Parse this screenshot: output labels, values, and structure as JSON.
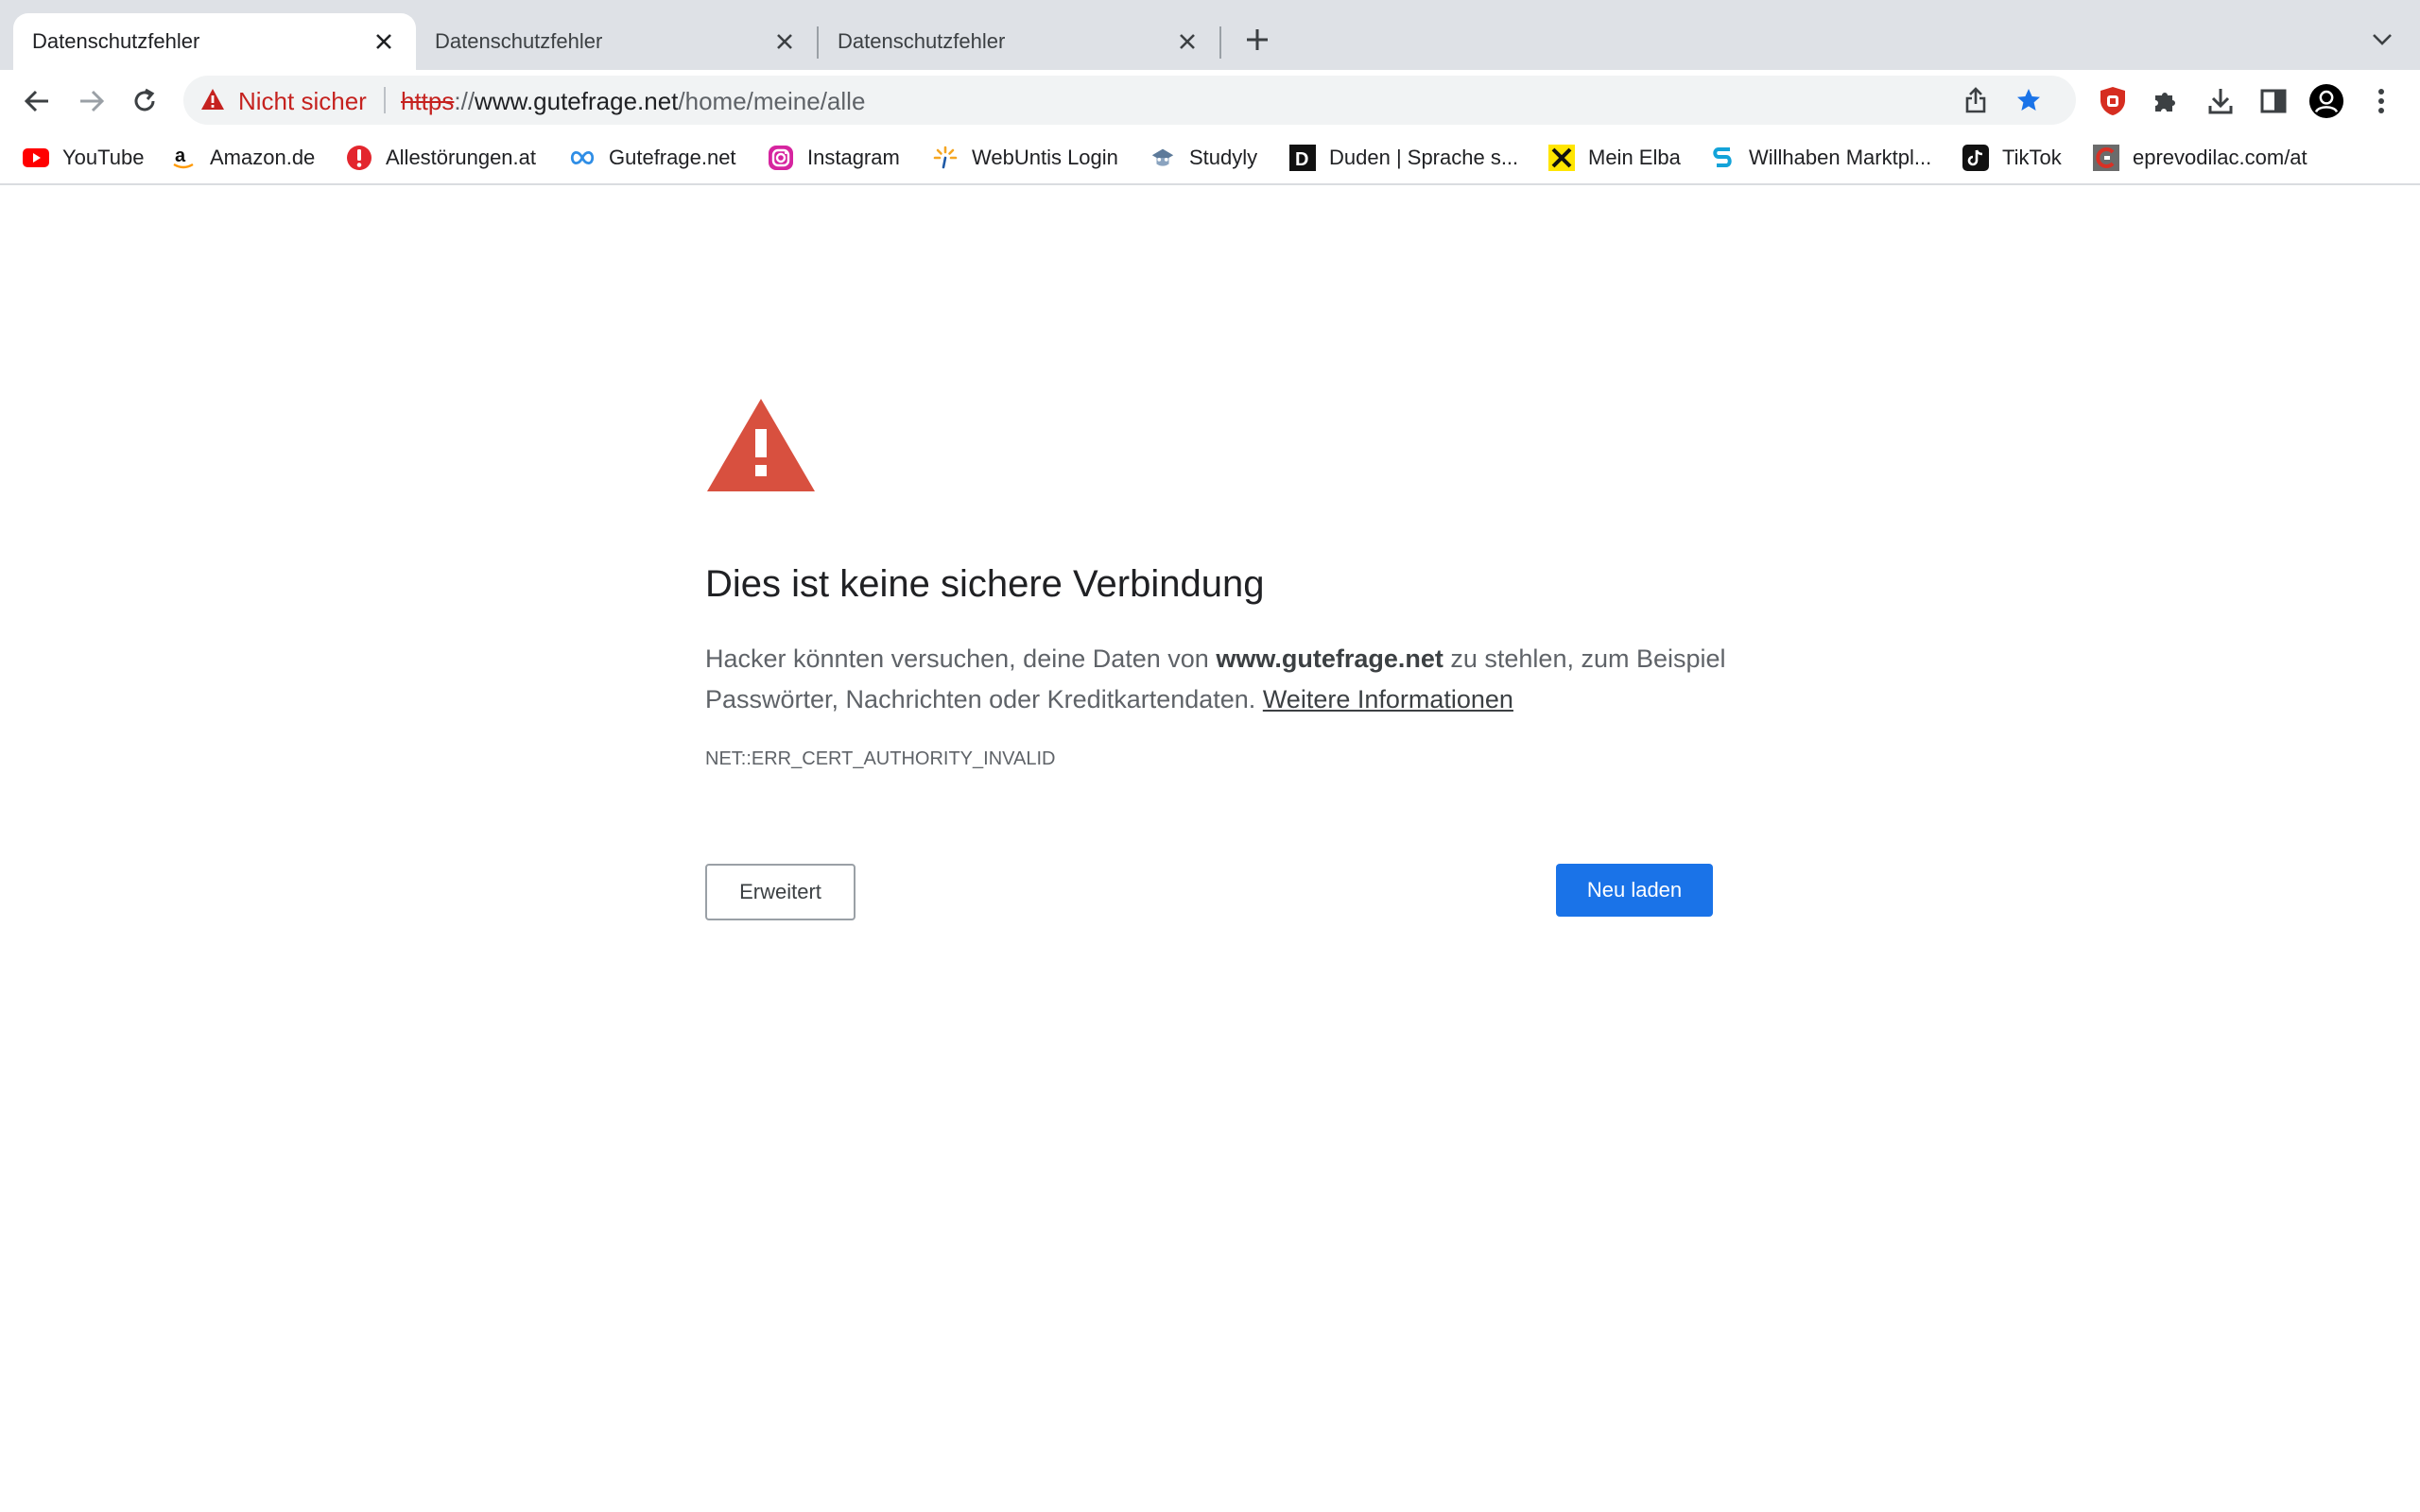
{
  "tabs": [
    {
      "title": "Datenschutzfehler",
      "active": true
    },
    {
      "title": "Datenschutzfehler",
      "active": false
    },
    {
      "title": "Datenschutzfehler",
      "active": false
    }
  ],
  "omnibox": {
    "security_status": "Nicht sicher",
    "url_scheme": "https",
    "url_separator": "://",
    "url_host": "www.gutefrage.net",
    "url_path": "/home/meine/alle"
  },
  "bookmarks": [
    {
      "label": "YouTube",
      "icon": "youtube-icon"
    },
    {
      "label": "Amazon.de",
      "icon": "amazon-icon"
    },
    {
      "label": "Allestörungen.at",
      "icon": "allestoerungen-icon"
    },
    {
      "label": "Gutefrage.net",
      "icon": "gutefrage-icon"
    },
    {
      "label": "Instagram",
      "icon": "instagram-icon"
    },
    {
      "label": "WebUntis Login",
      "icon": "webuntis-icon"
    },
    {
      "label": "Studyly",
      "icon": "studyly-icon"
    },
    {
      "label": "Duden | Sprache s...",
      "icon": "duden-icon"
    },
    {
      "label": "Mein Elba",
      "icon": "raiffeisen-icon"
    },
    {
      "label": "Willhaben Marktpl...",
      "icon": "willhaben-icon"
    },
    {
      "label": "TikTok",
      "icon": "tiktok-icon"
    },
    {
      "label": "eprevodilac.com/at",
      "icon": "eprevodilac-icon"
    }
  ],
  "interstitial": {
    "heading": "Dies ist keine sichere Verbindung",
    "body_prefix": "Hacker könnten versuchen, deine Daten von ",
    "body_host": "www.gutefrage.net",
    "body_suffix": " zu stehlen, zum Beispiel Passwörter, Nachrichten oder Kreditkartendaten. ",
    "learn_more": "Weitere Informationen",
    "error_code": "NET::ERR_CERT_AUTHORITY_INVALID",
    "advanced_label": "Erweitert",
    "reload_label": "Neu laden"
  },
  "colors": {
    "tabstrip_bg": "#dee1e6",
    "omnibox_bg": "#f1f3f4",
    "danger": "#c5221f",
    "warning_icon": "#d8503f",
    "primary_button": "#1a73e8",
    "bookmark_star": "#1a73e8"
  }
}
